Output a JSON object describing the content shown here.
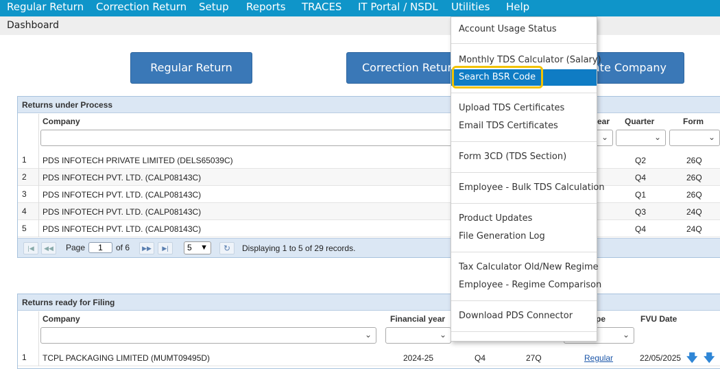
{
  "nav": {
    "items": [
      "Regular Return",
      "Correction Return",
      "Setup",
      "Reports",
      "TRACES",
      "IT Portal / NSDL",
      "Utilities",
      "Help"
    ]
  },
  "breadcrumb": "Dashboard",
  "buttons": {
    "regular": "Regular Return",
    "correction": "Correction Return",
    "company": "ate Company"
  },
  "process": {
    "title": "Returns under Process",
    "col_company": "Company",
    "col_year": "ear",
    "col_quarter": "Quarter",
    "col_form": "Form",
    "rows": [
      {
        "num": "1",
        "company": "PDS INFOTECH PRIVATE LIMITED (DELS65039C)",
        "quarter": "Q2",
        "form": "26Q"
      },
      {
        "num": "2",
        "company": "PDS INFOTECH PVT. LTD. (CALP08143C)",
        "quarter": "Q4",
        "form": "26Q"
      },
      {
        "num": "3",
        "company": "PDS INFOTECH PVT. LTD. (CALP08143C)",
        "quarter": "Q1",
        "form": "26Q"
      },
      {
        "num": "4",
        "company": "PDS INFOTECH PVT. LTD. (CALP08143C)",
        "quarter": "Q3",
        "form": "24Q"
      },
      {
        "num": "5",
        "company": "PDS INFOTECH PVT. LTD. (CALP08143C)",
        "quarter": "Q4",
        "form": "24Q"
      }
    ],
    "pager": {
      "page_label": "Page",
      "page_value": "1",
      "of_label": "of 6",
      "page_size": "5",
      "status": "Displaying 1 to 5 of 29 records."
    }
  },
  "filing": {
    "title": "Returns ready for Filing",
    "col_company": "Company",
    "col_fy": "Financial year",
    "col_type": "pe",
    "col_fvu": "FVU Date",
    "row": {
      "num": "1",
      "company": "TCPL PACKAGING LIMITED (MUMT09495D)",
      "fy": "2024-25",
      "quarter": "Q4",
      "form": "27Q",
      "type": "Regular",
      "fvu": "22/05/2025"
    }
  },
  "menu": {
    "items": [
      "Account Usage Status",
      "Monthly TDS Calculator (Salary)",
      "Search BSR Code",
      "Upload TDS Certificates",
      "Email TDS Certificates",
      "Form 3CD (TDS Section)",
      "Employee - Bulk TDS Calculation",
      "Product Updates",
      "File Generation Log",
      "Tax Calculator Old/New Regime",
      "Employee - Regime Comparison",
      "Download PDS Connector"
    ]
  },
  "colors": {
    "nav_bg": "#0f95c9",
    "button_bg": "#3a78b7",
    "menu_active": "#0f7cc4",
    "highlight": "#f2c200"
  },
  "icons": [
    "first-page-icon",
    "prev-page-icon",
    "next-page-icon",
    "last-page-icon",
    "refresh-icon",
    "chevron-down-icon",
    "download-arrow-icon"
  ]
}
